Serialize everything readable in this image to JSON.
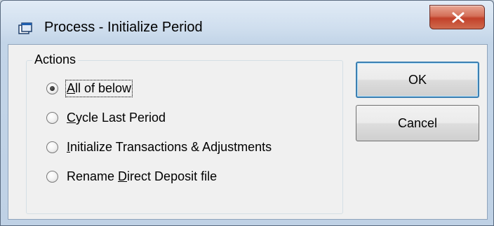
{
  "window": {
    "title": "Process - Initialize Period",
    "close_glyph": "×",
    "app_icon": "window-app-icon"
  },
  "actions_group": {
    "legend": "Actions",
    "options": [
      {
        "mnemonic": "A",
        "rest": "ll of below",
        "checked": true
      },
      {
        "mnemonic": "C",
        "rest": "ycle Last Period",
        "checked": false
      },
      {
        "mnemonic": "I",
        "rest": "nitialize Transactions & Adjustments",
        "checked": false
      },
      {
        "prefix": "Rename ",
        "mnemonic": "D",
        "rest": "irect Deposit file",
        "checked": false
      }
    ]
  },
  "buttons": {
    "ok_label": "OK",
    "cancel_label": "Cancel"
  },
  "colors": {
    "title_bar": "#cfdeee",
    "close_button": "#c2412a",
    "client_background": "#f0f0f0"
  }
}
